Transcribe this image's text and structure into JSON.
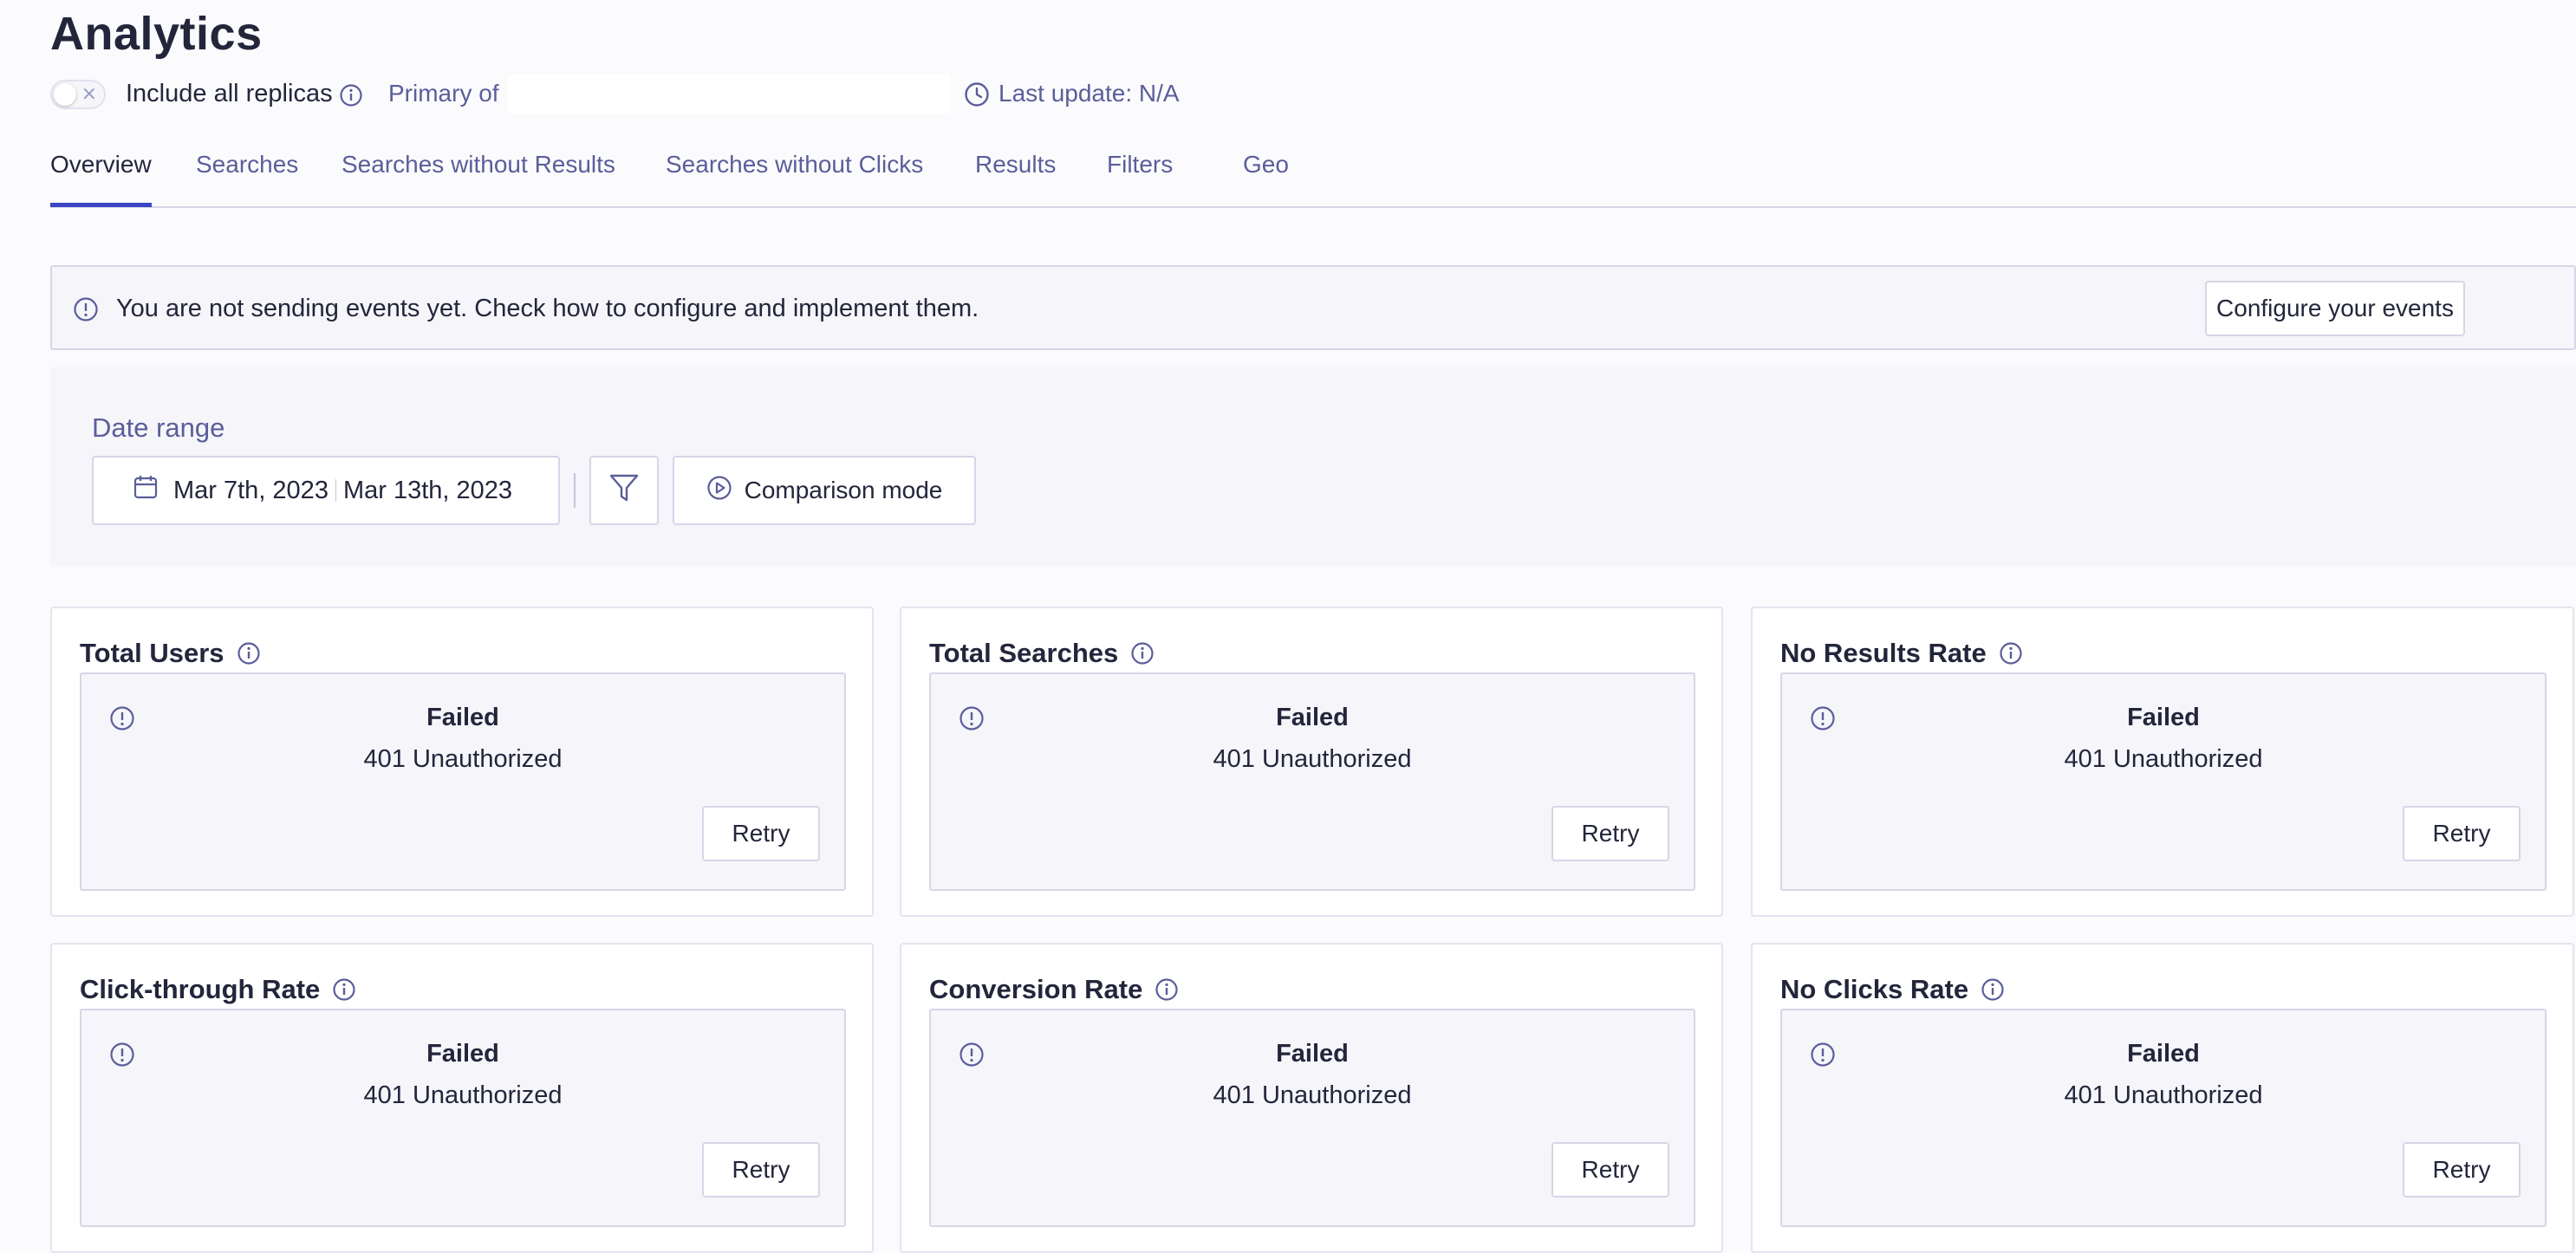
{
  "header": {
    "title": "Analytics",
    "replicas_label": "Include all replicas",
    "primary_label": "Primary of",
    "primary_value": "",
    "last_update": "Last update: N/A"
  },
  "tabs": [
    {
      "label": "Overview",
      "active": true
    },
    {
      "label": "Searches",
      "active": false
    },
    {
      "label": "Searches without Results",
      "active": false
    },
    {
      "label": "Searches without Clicks",
      "active": false
    },
    {
      "label": "Results",
      "active": false
    },
    {
      "label": "Filters",
      "active": false
    },
    {
      "label": "Geo",
      "active": false
    }
  ],
  "banner": {
    "text": "You are not sending events yet. Check how to configure and implement them.",
    "button_label": "Configure your events",
    "close_glyph": "×"
  },
  "date_range": {
    "label": "Date range",
    "start": "Mar 7th, 2023",
    "end": "Mar 13th, 2023",
    "comparison_label": "Comparison mode"
  },
  "cards": [
    {
      "title": "Total Users",
      "error_title": "Failed",
      "error_message": "401 Unauthorized",
      "retry_label": "Retry"
    },
    {
      "title": "Total Searches",
      "error_title": "Failed",
      "error_message": "401 Unauthorized",
      "retry_label": "Retry"
    },
    {
      "title": "No Results Rate",
      "error_title": "Failed",
      "error_message": "401 Unauthorized",
      "retry_label": "Retry"
    },
    {
      "title": "Click-through Rate",
      "error_title": "Failed",
      "error_message": "401 Unauthorized",
      "retry_label": "Retry"
    },
    {
      "title": "Conversion Rate",
      "error_title": "Failed",
      "error_message": "401 Unauthorized",
      "retry_label": "Retry"
    },
    {
      "title": "No Clicks Rate",
      "error_title": "Failed",
      "error_message": "401 Unauthorized",
      "retry_label": "Retry"
    }
  ],
  "colors": {
    "accent": "#3a46c4",
    "text": "#23263b",
    "muted": "#5a5e9a",
    "panel": "#f5f5fa",
    "border": "#d6d6e7"
  }
}
